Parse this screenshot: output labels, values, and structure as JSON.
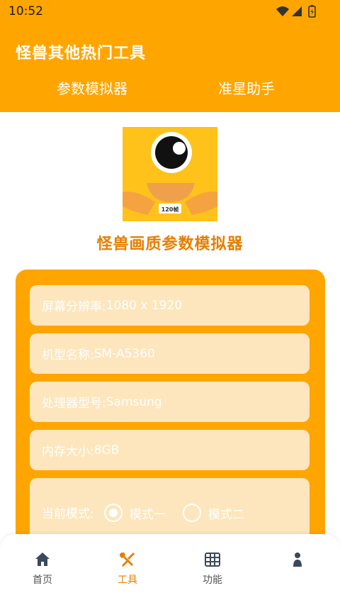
{
  "status_bar": {
    "time": "10:52"
  },
  "header": {
    "title": "怪兽其他热门工具",
    "tabs": [
      {
        "label": "参数模拟器"
      },
      {
        "label": "准星助手"
      }
    ]
  },
  "logo": {
    "badge": "120帧"
  },
  "main": {
    "title": "怪兽画质参数模拟器",
    "fields": [
      {
        "label": "屏幕分辨率:",
        "value": "1080 x 1920"
      },
      {
        "label": "机型名称:",
        "value": "SM-A5360"
      },
      {
        "label": "处理器型号:",
        "value": "Samsung"
      },
      {
        "label": "内存大小:",
        "value": "8GB"
      }
    ],
    "mode": {
      "label": "当前模式:",
      "options": [
        {
          "label": "模式一",
          "selected": true
        },
        {
          "label": "模式二",
          "selected": false
        }
      ]
    }
  },
  "bottom_nav": {
    "items": [
      {
        "label": "首页",
        "icon": "home-icon"
      },
      {
        "label": "工具",
        "icon": "tools-icon",
        "active": true
      },
      {
        "label": "功能",
        "icon": "grid-icon"
      },
      {
        "label": "",
        "icon": "profile-icon"
      }
    ]
  },
  "colors": {
    "accent": "#ffa500",
    "accent_dark": "#e67e00",
    "field_bg": "#fde6bd"
  }
}
